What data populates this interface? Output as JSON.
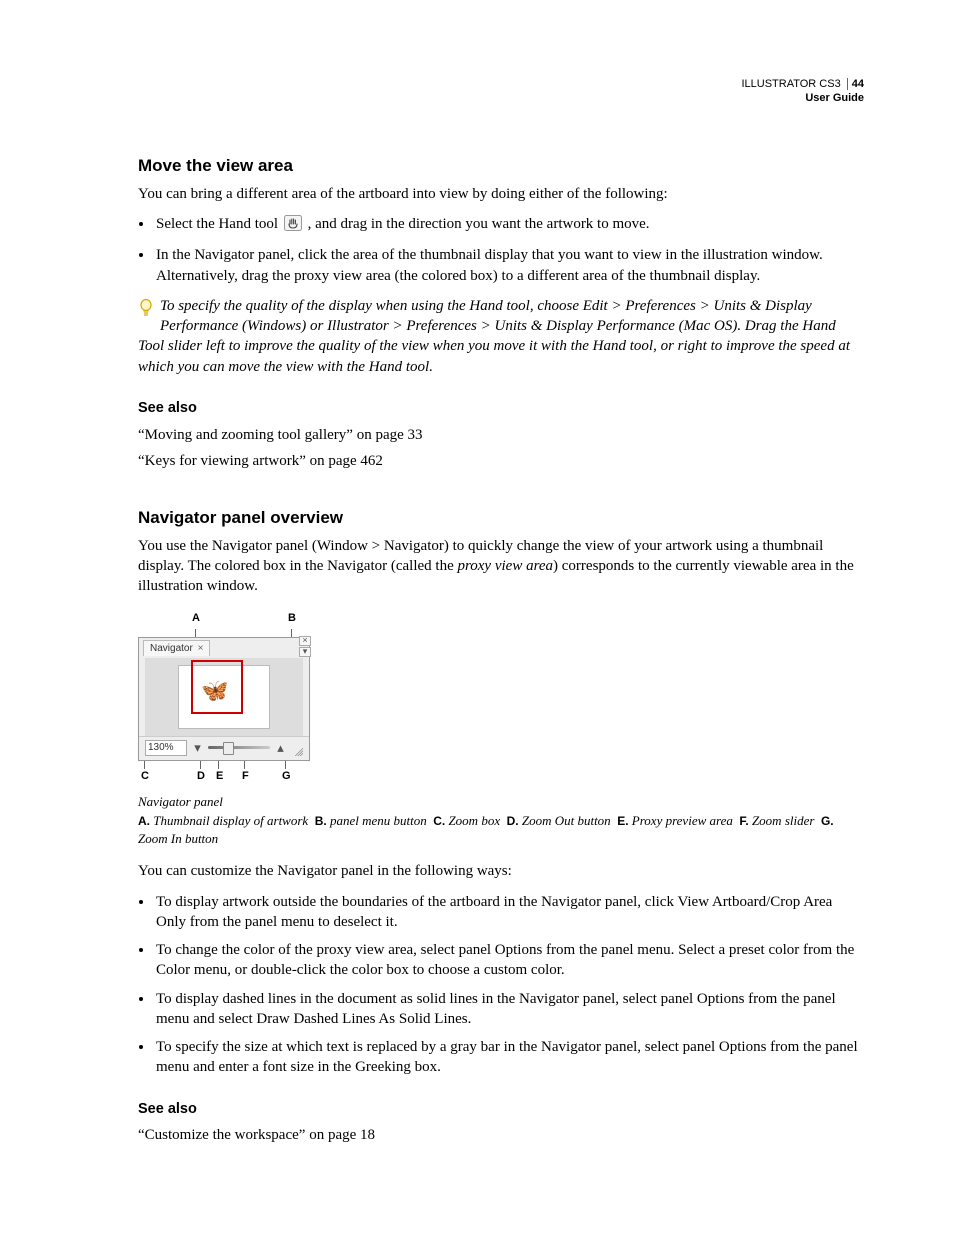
{
  "header": {
    "product": "ILLUSTRATOR CS3",
    "page_number": "44",
    "subtitle": "User Guide"
  },
  "section1": {
    "heading": "Move the view area",
    "intro": "You can bring a different area of the artboard into view by doing either of the following:",
    "bullet1a": "Select the Hand tool ",
    "bullet1b": " , and drag in the direction you want the artwork to move.",
    "bullet2": "In the Navigator panel, click the area of the thumbnail display that you want to view in the illustration window. Alternatively, drag the proxy view area (the colored box) to a different area of the thumbnail display.",
    "tip": "To specify the quality of the display when using the Hand tool, choose Edit > Preferences > Units & Display Performance (Windows) or Illustrator > Preferences > Units & Display Performance (Mac OS). Drag the Hand Tool slider left to improve the quality of the view when you move it with the Hand tool, or right to improve the speed at which you can move the view with the Hand tool.",
    "see_also_heading": "See also",
    "see_also_1": "“Moving and zooming tool gallery” on page 33",
    "see_also_2": "“Keys for viewing artwork” on page 462"
  },
  "section2": {
    "heading": "Navigator panel overview",
    "para1a": "You use the Navigator panel (Window > Navigator) to quickly change the view of your artwork using a thumbnail display. The colored box in the Navigator (called the ",
    "para1_em": "proxy view area",
    "para1b": ") corresponds to the currently viewable area in the illustration window.",
    "figure": {
      "callouts_top": [
        "A",
        "B"
      ],
      "callouts_bottom": [
        "C",
        "D",
        "E",
        "F",
        "G"
      ],
      "tab_label": "Navigator",
      "zoom_value": "130%",
      "caption": "Navigator panel",
      "legend": {
        "A": "Thumbnail display of artwork",
        "B": "panel menu button",
        "C": "Zoom box",
        "D": "Zoom Out button",
        "E": "Proxy preview area",
        "F": "Zoom slider",
        "G": "Zoom In button"
      }
    },
    "para2": "You can customize the Navigator panel in the following ways:",
    "bullets": [
      "To display artwork outside the boundaries of the artboard in the Navigator panel, click View Artboard/Crop Area Only from the panel menu to deselect it.",
      "To change the color of the proxy view area, select panel Options from the panel menu. Select a preset color from the Color menu, or double-click the color box to choose a custom color.",
      "To display dashed lines in the document as solid lines in the Navigator panel, select panel Options from the panel menu and select Draw Dashed Lines As Solid Lines.",
      "To specify the size at which text is replaced by a gray bar in the Navigator panel, select panel Options from the panel menu and enter a font size in the Greeking box."
    ],
    "see_also_heading": "See also",
    "see_also_1": "“Customize the workspace” on page 18"
  }
}
